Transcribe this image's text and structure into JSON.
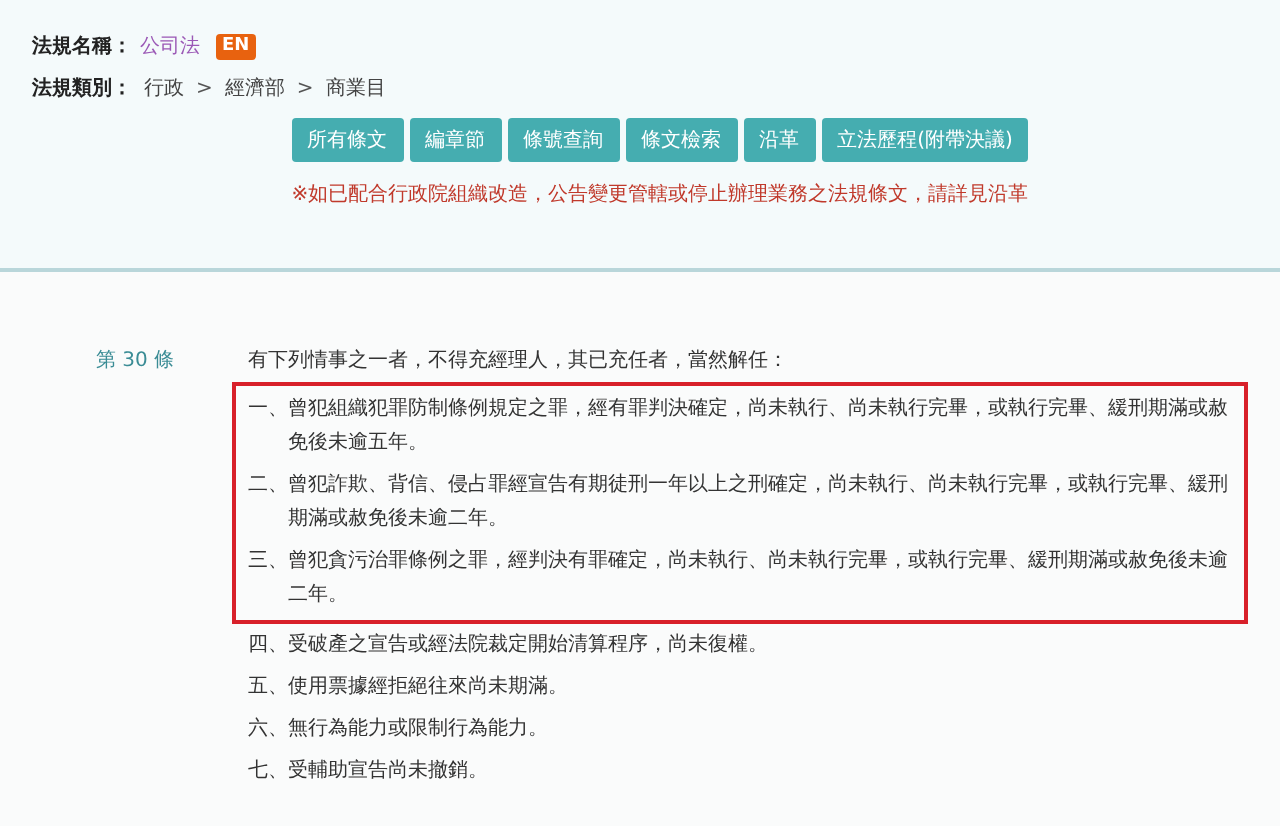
{
  "law_name": {
    "label": "法規名稱：",
    "value": "公司法",
    "badge": "EN"
  },
  "law_category": {
    "label": "法規類別：",
    "path": [
      "行政",
      "經濟部",
      "商業目"
    ],
    "separator": ">"
  },
  "buttons": [
    "所有條文",
    "編章節",
    "條號查詢",
    "條文檢索",
    "沿革",
    "立法歷程(附帶決議)"
  ],
  "notice": "※如已配合行政院組織改造，公告變更管轄或停止辦理業務之法規條文，請詳見沿革",
  "article": {
    "number": "第 30 條",
    "intro": "有下列情事之一者，不得充經理人，其已充任者，當然解任：",
    "items": [
      {
        "text": "一、曾犯組織犯罪防制條例規定之罪，經有罪判決確定，尚未執行、尚未執行完畢，或執行完畢、緩刑期滿或赦免後未逾五年。",
        "highlighted": true
      },
      {
        "text": "二、曾犯詐欺、背信、侵占罪經宣告有期徒刑一年以上之刑確定，尚未執行、尚未執行完畢，或執行完畢、緩刑期滿或赦免後未逾二年。",
        "highlighted": true
      },
      {
        "text": "三、曾犯貪污治罪條例之罪，經判決有罪確定，尚未執行、尚未執行完畢，或執行完畢、緩刑期滿或赦免後未逾二年。",
        "highlighted": true
      },
      {
        "text": "四、受破產之宣告或經法院裁定開始清算程序，尚未復權。",
        "highlighted": false
      },
      {
        "text": "五、使用票據經拒絕往來尚未期滿。",
        "highlighted": false
      },
      {
        "text": "六、無行為能力或限制行為能力。",
        "highlighted": false
      },
      {
        "text": "七、受輔助宣告尚未撤銷。",
        "highlighted": false
      }
    ]
  }
}
